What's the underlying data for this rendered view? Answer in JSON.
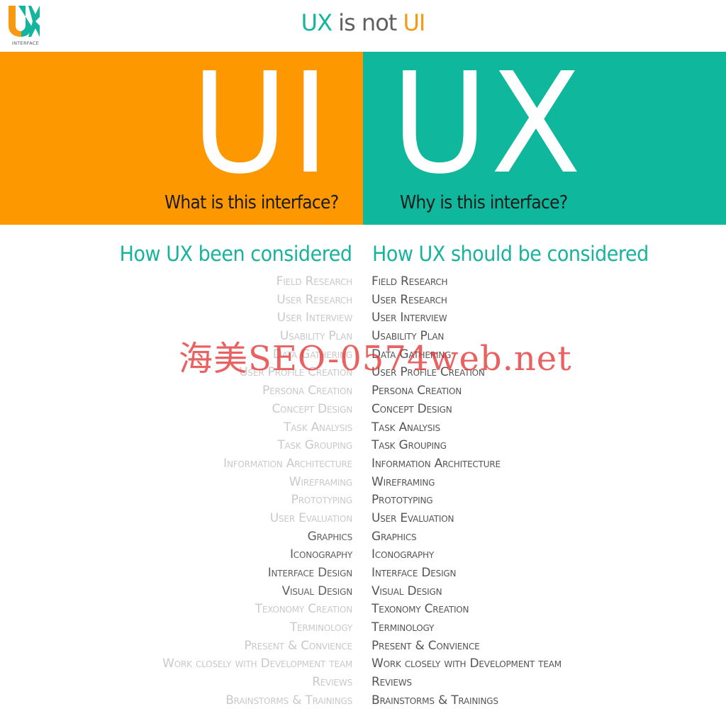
{
  "header": {
    "logo_text": "INTERFACE",
    "title_parts": {
      "ux": "UX",
      "middle": " is not ",
      "ui": "UI"
    }
  },
  "colors": {
    "orange": "#fd9800",
    "teal": "#0fb89d",
    "heading_teal": "#17b39c",
    "faded_gray": "#c9c9c9",
    "dark_gray": "#555555",
    "watermark_red": "#e43434"
  },
  "banner": {
    "ui": {
      "big": "UI",
      "caption": "What is this interface?"
    },
    "ux": {
      "big": "UX",
      "caption": "Why is this interface?"
    }
  },
  "columns": {
    "left_heading": "How UX been considered",
    "right_heading": "How UX should be considered",
    "items": [
      {
        "label": "Field Research",
        "left_emphasized": false
      },
      {
        "label": "User Research",
        "left_emphasized": false
      },
      {
        "label": "User Interview",
        "left_emphasized": false
      },
      {
        "label": "Usability Plan",
        "left_emphasized": false
      },
      {
        "label": "Data Gathering",
        "left_emphasized": false
      },
      {
        "label": "User Profile Creation",
        "left_emphasized": false
      },
      {
        "label": "Persona Creation",
        "left_emphasized": false
      },
      {
        "label": "Concept Design",
        "left_emphasized": false
      },
      {
        "label": "Task Analysis",
        "left_emphasized": false
      },
      {
        "label": "Task Grouping",
        "left_emphasized": false
      },
      {
        "label": "Information Architecture",
        "left_emphasized": false
      },
      {
        "label": "Wireframing",
        "left_emphasized": false
      },
      {
        "label": "Prototyping",
        "left_emphasized": false
      },
      {
        "label": "User Evaluation",
        "left_emphasized": false
      },
      {
        "label": "Graphics",
        "left_emphasized": true
      },
      {
        "label": "Iconography",
        "left_emphasized": true
      },
      {
        "label": "Interface Design",
        "left_emphasized": true
      },
      {
        "label": "Visual Design",
        "left_emphasized": true
      },
      {
        "label": "Texonomy Creation",
        "left_emphasized": false
      },
      {
        "label": "Terminology",
        "left_emphasized": false
      },
      {
        "label": "Present & Convience",
        "left_emphasized": false
      },
      {
        "label": "Work closely with Development team",
        "left_emphasized": false
      },
      {
        "label": "Reviews",
        "left_emphasized": false
      },
      {
        "label": "Brainstorms & Trainings",
        "left_emphasized": false
      }
    ]
  },
  "watermark": "海美SEO-0574web.net"
}
